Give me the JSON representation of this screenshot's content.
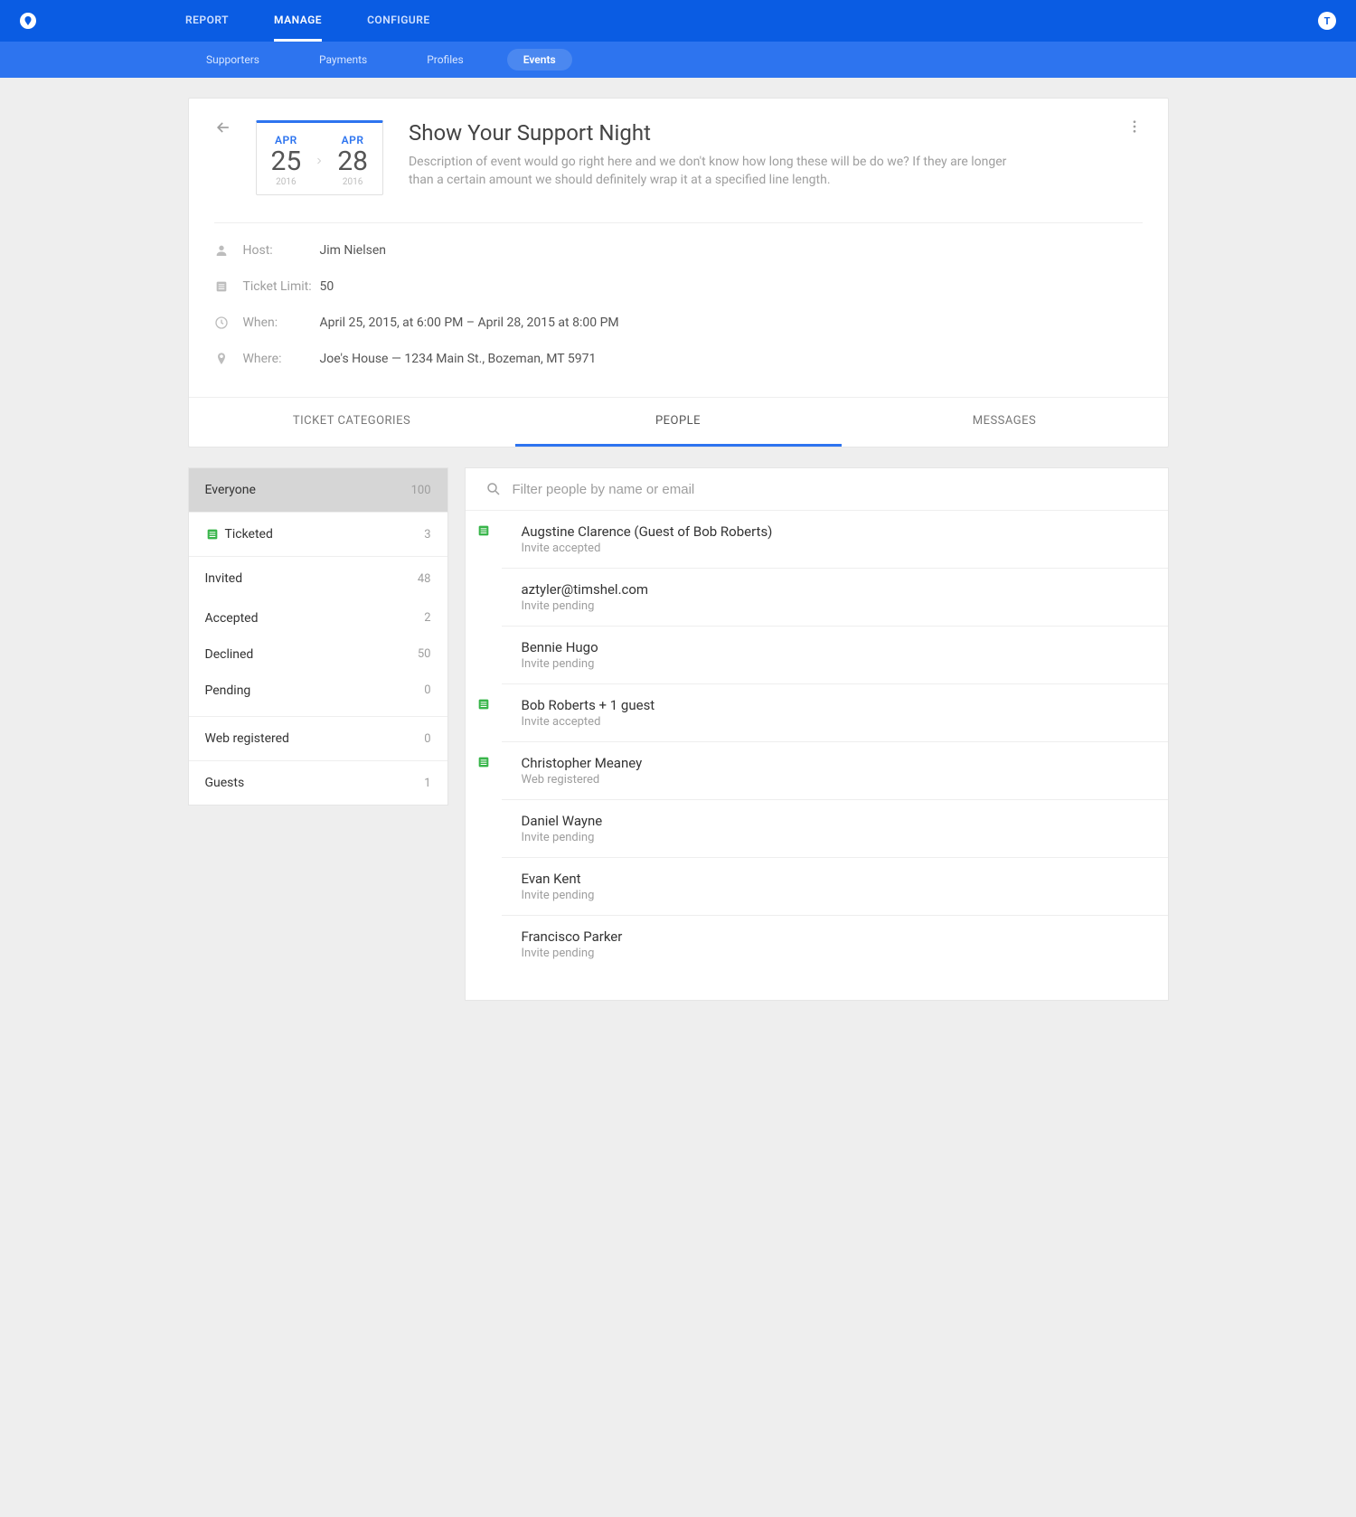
{
  "nav": {
    "primary": [
      {
        "label": "REPORT",
        "active": false
      },
      {
        "label": "MANAGE",
        "active": true
      },
      {
        "label": "CONFIGURE",
        "active": false
      }
    ],
    "secondary": [
      {
        "label": "Supporters",
        "active": false
      },
      {
        "label": "Payments",
        "active": false
      },
      {
        "label": "Profiles",
        "active": false
      },
      {
        "label": "Events",
        "active": true
      }
    ],
    "avatar_letter": "T"
  },
  "event": {
    "start": {
      "month": "APR",
      "day": "25",
      "year": "2016"
    },
    "end": {
      "month": "APR",
      "day": "28",
      "year": "2016"
    },
    "title": "Show Your Support Night",
    "description": "Description of event would go right here and we don't know how long these will be do we? If they are longer than a certain amount we should definitely wrap it at a specified line length.",
    "meta": {
      "host_label": "Host:",
      "host_value": "Jim Nielsen",
      "limit_label": "Ticket Limit:",
      "limit_value": "50",
      "when_label": "When:",
      "when_value": "April 25, 2015, at 6:00 PM – April 28, 2015 at 8:00 PM",
      "where_label": "Where:",
      "where_value": "Joe's House — 1234 Main St., Bozeman, MT 5971"
    }
  },
  "subtabs": [
    {
      "label": "TICKET CATEGORIES",
      "active": false
    },
    {
      "label": "PEOPLE",
      "active": true
    },
    {
      "label": "MESSAGES",
      "active": false
    }
  ],
  "sidebar": {
    "everyone": {
      "label": "Everyone",
      "count": "100"
    },
    "ticketed": {
      "label": "Ticketed",
      "count": "3"
    },
    "invited_group": {
      "top": {
        "label": "Invited",
        "count": "48"
      },
      "items": [
        {
          "label": "Accepted",
          "count": "2"
        },
        {
          "label": "Declined",
          "count": "50"
        },
        {
          "label": "Pending",
          "count": "0"
        }
      ]
    },
    "web_registered": {
      "label": "Web registered",
      "count": "0"
    },
    "guests": {
      "label": "Guests",
      "count": "1"
    }
  },
  "search": {
    "placeholder": "Filter people by name or email"
  },
  "people": [
    {
      "name": "Augstine Clarence (Guest of Bob Roberts)",
      "status": "Invite accepted",
      "ticketed": true
    },
    {
      "name": "aztyler@timshel.com",
      "status": "Invite pending",
      "ticketed": false
    },
    {
      "name": "Bennie Hugo",
      "status": "Invite pending",
      "ticketed": false
    },
    {
      "name": "Bob Roberts + 1 guest",
      "status": "Invite accepted",
      "ticketed": true
    },
    {
      "name": "Christopher Meaney",
      "status": "Web registered",
      "ticketed": true
    },
    {
      "name": "Daniel Wayne",
      "status": "Invite pending",
      "ticketed": false
    },
    {
      "name": "Evan Kent",
      "status": "Invite pending",
      "ticketed": false
    },
    {
      "name": "Francisco Parker",
      "status": "Invite pending",
      "ticketed": false
    }
  ]
}
